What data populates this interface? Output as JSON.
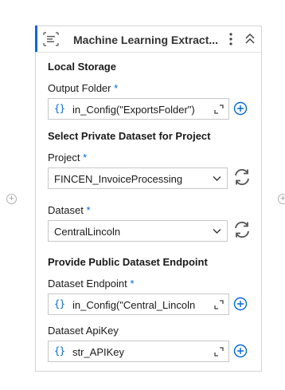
{
  "activity": {
    "title": "Machine Learning Extract...",
    "icons": {
      "activity": "ml-extractor-icon",
      "menu": "more-vertical-icon",
      "collapse": "collapse-up-icon"
    }
  },
  "local_storage": {
    "heading": "Local Storage",
    "output_folder": {
      "label": "Output Folder",
      "required": "*",
      "expr_badge": "{}",
      "value": "in_Config(\"ExportsFolder\")"
    }
  },
  "private_dataset": {
    "heading": "Select Private Dataset for Project",
    "project": {
      "label": "Project",
      "required": "*",
      "value": "FINCEN_InvoiceProcessing"
    },
    "dataset": {
      "label": "Dataset",
      "required": "*",
      "value": "CentralLincoln"
    }
  },
  "public_endpoint": {
    "heading": "Provide Public Dataset Endpoint",
    "endpoint": {
      "label": "Dataset Endpoint",
      "required": "*",
      "expr_badge": "{}",
      "value": "in_Config(\"Central_Lincoln"
    },
    "api_key": {
      "label": "Dataset ApiKey",
      "expr_badge": "{}",
      "value": "str_APIKey"
    }
  },
  "canvas": {
    "add_glyph": "+"
  },
  "colors": {
    "accent": "#0067df",
    "border": "#c8c8c8"
  }
}
